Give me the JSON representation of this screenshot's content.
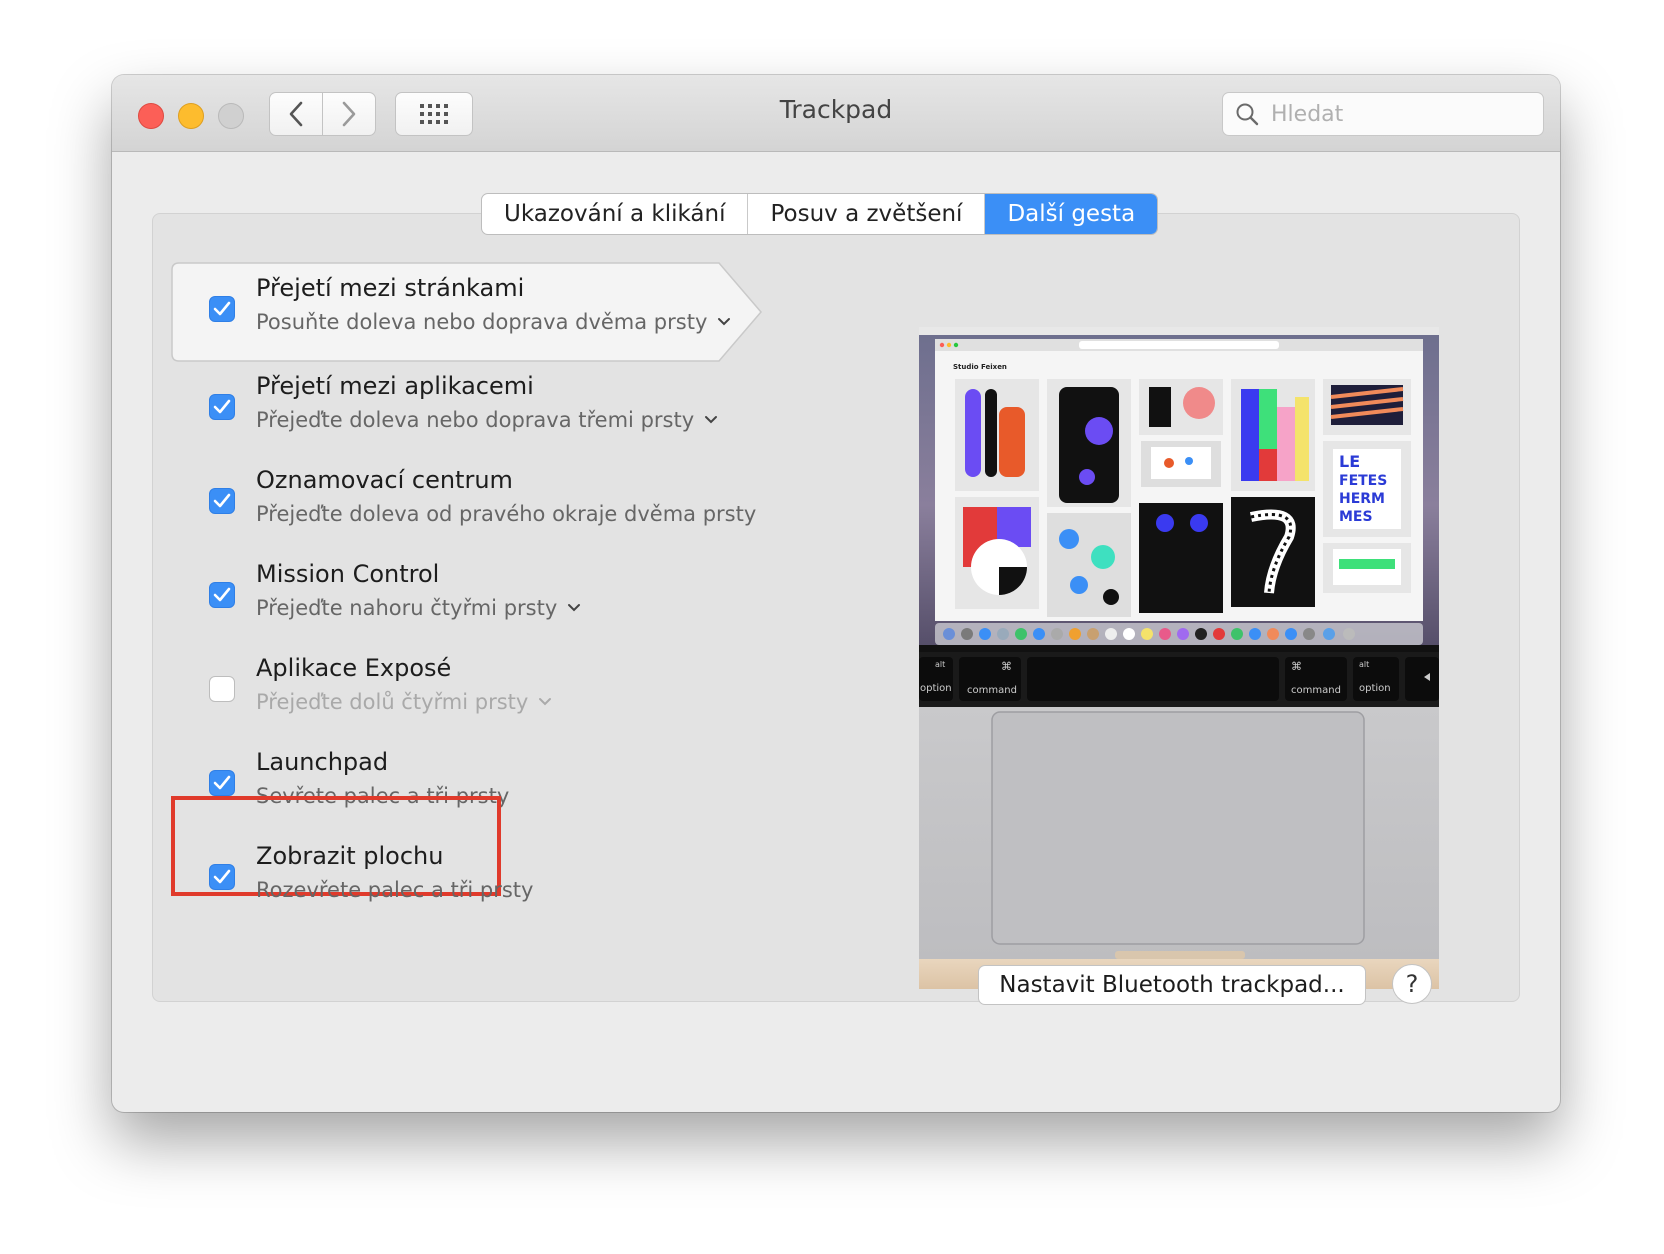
{
  "window": {
    "title": "Trackpad"
  },
  "search": {
    "placeholder": "Hledat"
  },
  "tabs": [
    {
      "label": "Ukazování a klikání",
      "active": false
    },
    {
      "label": "Posuv a zvětšení",
      "active": false
    },
    {
      "label": "Další gesta",
      "active": true
    }
  ],
  "gestures": [
    {
      "title": "Přejetí mezi stránkami",
      "subtitle": "Posuňte doleva nebo doprava dvěma prsty",
      "checked": true,
      "has_menu": true
    },
    {
      "title": "Přejetí mezi aplikacemi",
      "subtitle": "Přejeďte doleva nebo doprava třemi prsty",
      "checked": true,
      "has_menu": true
    },
    {
      "title": "Oznamovací centrum",
      "subtitle": "Přejeďte doleva od pravého okraje dvěma prsty",
      "checked": true,
      "has_menu": false
    },
    {
      "title": "Mission Control",
      "subtitle": "Přejeďte nahoru čtyřmi prsty",
      "checked": true,
      "has_menu": true
    },
    {
      "title": "Aplikace Exposé",
      "subtitle": "Přejeďte dolů čtyřmi prsty",
      "checked": false,
      "has_menu": true
    },
    {
      "title": "Launchpad",
      "subtitle": "Sevřete palec a tři prsty",
      "checked": true,
      "has_menu": false
    },
    {
      "title": "Zobrazit plochu",
      "subtitle": "Rozevřete palec a tři prsty",
      "checked": true,
      "has_menu": false
    }
  ],
  "preview": {
    "site_title": "Studio Feixen",
    "keys": {
      "alt": "alt",
      "option": "option",
      "command": "command",
      "cmd_symbol": "⌘"
    }
  },
  "buttons": {
    "bluetooth": "Nastavit Bluetooth trackpad...",
    "help": "?"
  },
  "colors": {
    "accent": "#3b8ff6",
    "highlight": "#e03a2b"
  }
}
